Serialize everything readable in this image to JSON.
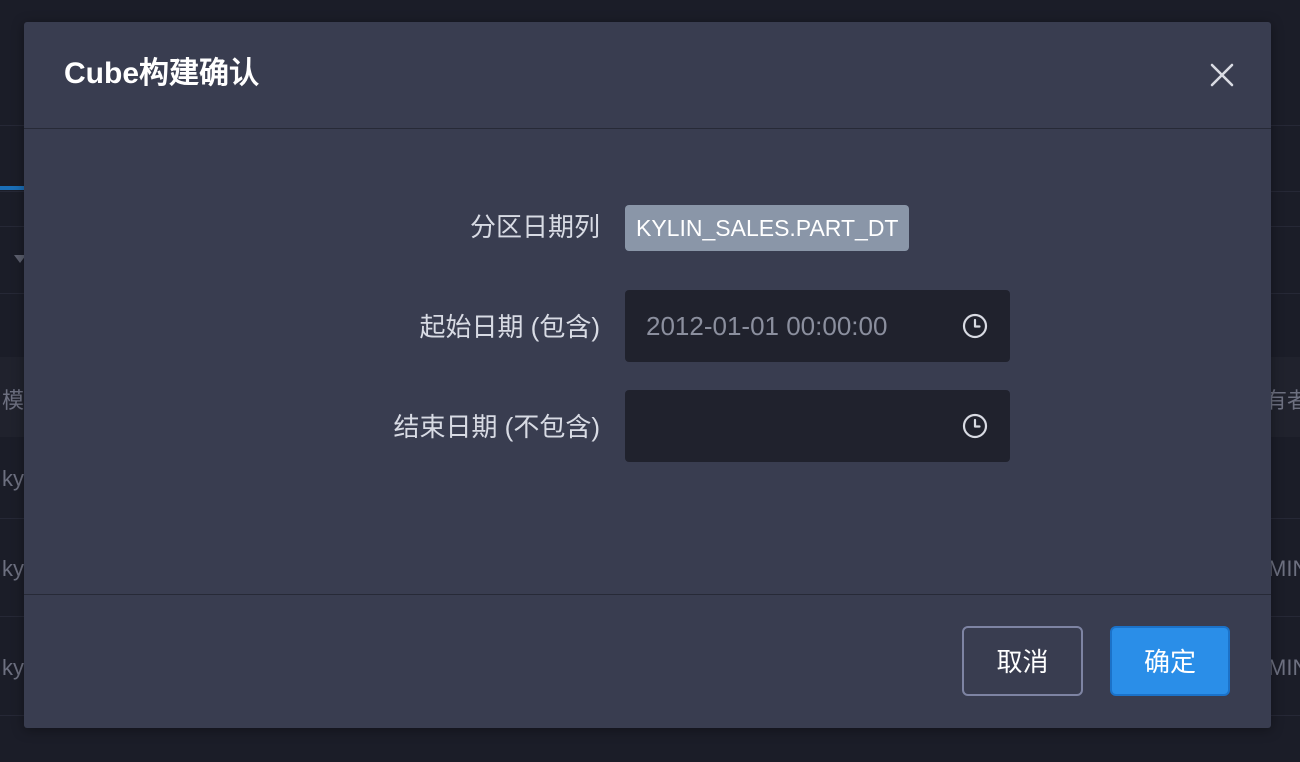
{
  "background": {
    "table_header_left": "模",
    "table_header_right": "有者",
    "row1_left": "ky",
    "row2_left": "ky",
    "row2_right": "MIN",
    "row3_left": "ky",
    "row3_right": "MIN"
  },
  "dialog": {
    "title": "Cube构建确认",
    "partition_label": "分区日期列",
    "partition_value": "KYLIN_SALES.PART_DT",
    "start_label": "起始日期 (包含)",
    "start_value": "2012-01-01 00:00:00",
    "end_label": "结束日期 (不包含)",
    "end_value": "",
    "cancel_label": "取消",
    "confirm_label": "确定"
  },
  "colors": {
    "accent": "#2a8ee8",
    "dialog_bg": "#393d50",
    "input_bg": "#20222d",
    "tag_bg": "#8a96a8"
  },
  "icons": [
    "close-icon",
    "clock-icon",
    "caret-down-icon"
  ]
}
